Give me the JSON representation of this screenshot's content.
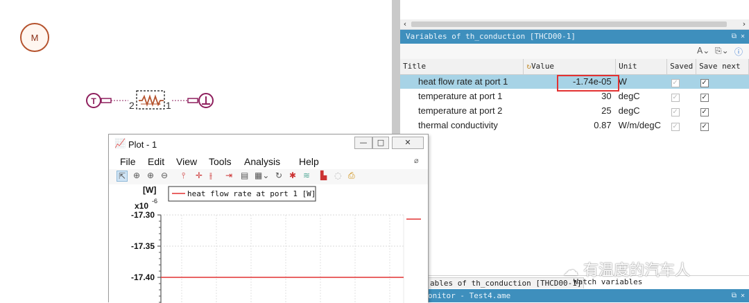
{
  "sketch": {
    "m_label": "M",
    "t_label": "T",
    "ground_label": "⊥",
    "port_left": "2",
    "port_right": "1",
    "accent": "#8e1f5d"
  },
  "variables": {
    "title": "Variables of th_conduction [THCD00-1]",
    "columns": [
      "Title",
      "Value",
      "Unit",
      "Saved",
      "Save next"
    ],
    "rows": [
      {
        "title": "heat flow rate at port 1",
        "value": "-1.74e-05",
        "unit": "W"
      },
      {
        "title": "temperature at port 1",
        "value": "30",
        "unit": "degC"
      },
      {
        "title": "temperature at port 2",
        "value": "25",
        "unit": "degC"
      },
      {
        "title": "thermal conductivity",
        "value": "0.87",
        "unit": "W/m/degC"
      }
    ]
  },
  "bottom": {
    "tab1": "ables of th_conduction [THCD00-1]",
    "tab2": "Watch variables",
    "monitor": "onitor - Test4.ame"
  },
  "watermark": "有温度的汽车人",
  "plot": {
    "window_title": "Plot - 1",
    "menu": {
      "file": "File",
      "edit": "Edit",
      "view": "View",
      "tools": "Tools",
      "analysis": "Analysis",
      "help": "Help"
    },
    "y_unit": "[W]",
    "y_scale": "x10",
    "y_exp": "-6",
    "legend": "heat flow rate at port 1 [W]",
    "series_color": "#e23131"
  },
  "chart_data": {
    "type": "line",
    "ylabel": "[W]",
    "yticks": [
      "-17.30",
      "-17.35",
      "-17.40"
    ],
    "ylim": [
      -17.43,
      -17.3
    ],
    "series": [
      {
        "name": "heat flow rate at port 1 [W]",
        "values": [
          -17.4,
          -17.4
        ]
      }
    ],
    "grid": true
  }
}
